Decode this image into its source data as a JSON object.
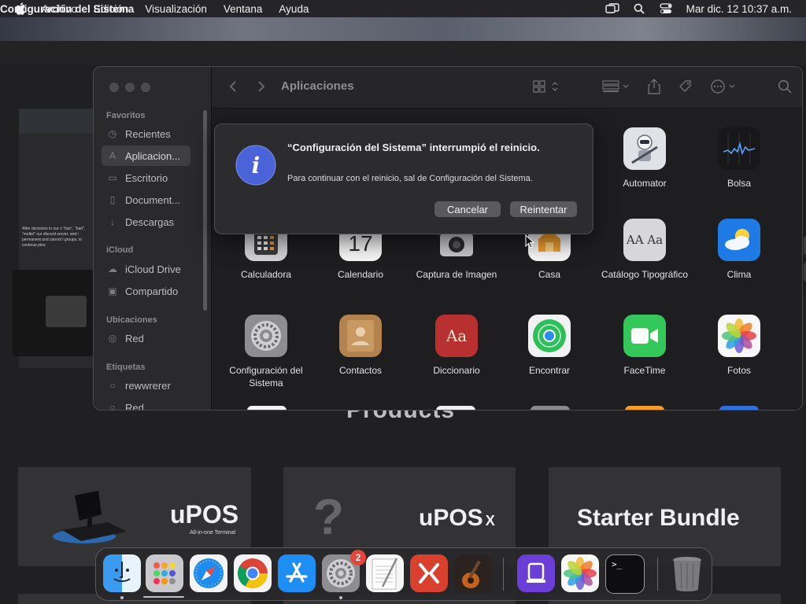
{
  "menubar": {
    "app_name": "Configuración del Sistema",
    "items": [
      "Archivo",
      "Edición",
      "Visualización",
      "Ventana",
      "Ayuda"
    ],
    "clock": "Mar dic. 12  10:37 a.m."
  },
  "background_page": {
    "products_title": "Products",
    "cards": [
      {
        "label": "uPOS",
        "sublabel": "All-in-one Terminal"
      },
      {
        "label": "uPOS",
        "label_suffix": "X"
      },
      {
        "label": "Starter Bundle"
      }
    ],
    "thumb_text": "After decisions in our o \"ban\", \"bad\", \"meltel\" our discord server, and i permanent and cannot l groups, to continue plea"
  },
  "finder": {
    "title": "Aplicaciones",
    "sidebar": {
      "sections": [
        {
          "label": "Favoritos",
          "items": [
            "Recientes",
            "Aplicacion...",
            "Escritorio",
            "Document...",
            "Descargas"
          ]
        },
        {
          "label": "iCloud",
          "items": [
            "iCloud Drive",
            "Compartido"
          ]
        },
        {
          "label": "Ubicaciones",
          "items": [
            "Red"
          ]
        },
        {
          "label": "Etiquetas",
          "items": [
            "rewwrerer",
            "Red"
          ]
        }
      ],
      "selected": "Aplicacion..."
    },
    "apps": [
      {
        "label": "Automator",
        "icon": "automator-icon"
      },
      {
        "label": "Bolsa",
        "icon": "stocks-icon"
      },
      {
        "label": "Calculadora",
        "icon": "calculator-icon"
      },
      {
        "label": "Calendario",
        "icon": "calendar-icon",
        "day": "17"
      },
      {
        "label": "Captura de Imagen",
        "icon": "image-capture-icon"
      },
      {
        "label": "Casa",
        "icon": "home-icon"
      },
      {
        "label": "Catálogo Tipográfico",
        "icon": "font-book-icon",
        "glyphs": "AA Aa"
      },
      {
        "label": "Clima",
        "icon": "weather-icon"
      },
      {
        "label": "Configuración del Sistema",
        "icon": "system-settings-icon"
      },
      {
        "label": "Contactos",
        "icon": "contacts-icon"
      },
      {
        "label": "Diccionario",
        "icon": "dictionary-icon",
        "glyph": "Aa"
      },
      {
        "label": "Encontrar",
        "icon": "find-my-icon"
      },
      {
        "label": "FaceTime",
        "icon": "facetime-icon"
      },
      {
        "label": "Fotos",
        "icon": "photos-icon"
      }
    ]
  },
  "alert": {
    "title": "“Configuración del Sistema” interrumpió el reinicio.",
    "message": "Para continuar con el reinicio, sal de Configuración del Sistema.",
    "cancel_label": "Cancelar",
    "retry_label": "Reintentar"
  },
  "dock": {
    "apps": [
      "finder-icon",
      "launchpad-icon",
      "safari-icon",
      "chrome-icon",
      "app-store-icon",
      "system-settings-icon",
      "textedit-icon",
      "remote-desktop-icon",
      "garageband-icon",
      "unknown-purple-icon",
      "photos-icon",
      "terminal-icon",
      "trash-icon"
    ],
    "settings_badge": "2",
    "terminal_glyph": ">_"
  },
  "colors": {
    "alert_info_blue": "#4a63d9",
    "badge_red": "#e5453b",
    "menubar_bg": "#252527"
  }
}
